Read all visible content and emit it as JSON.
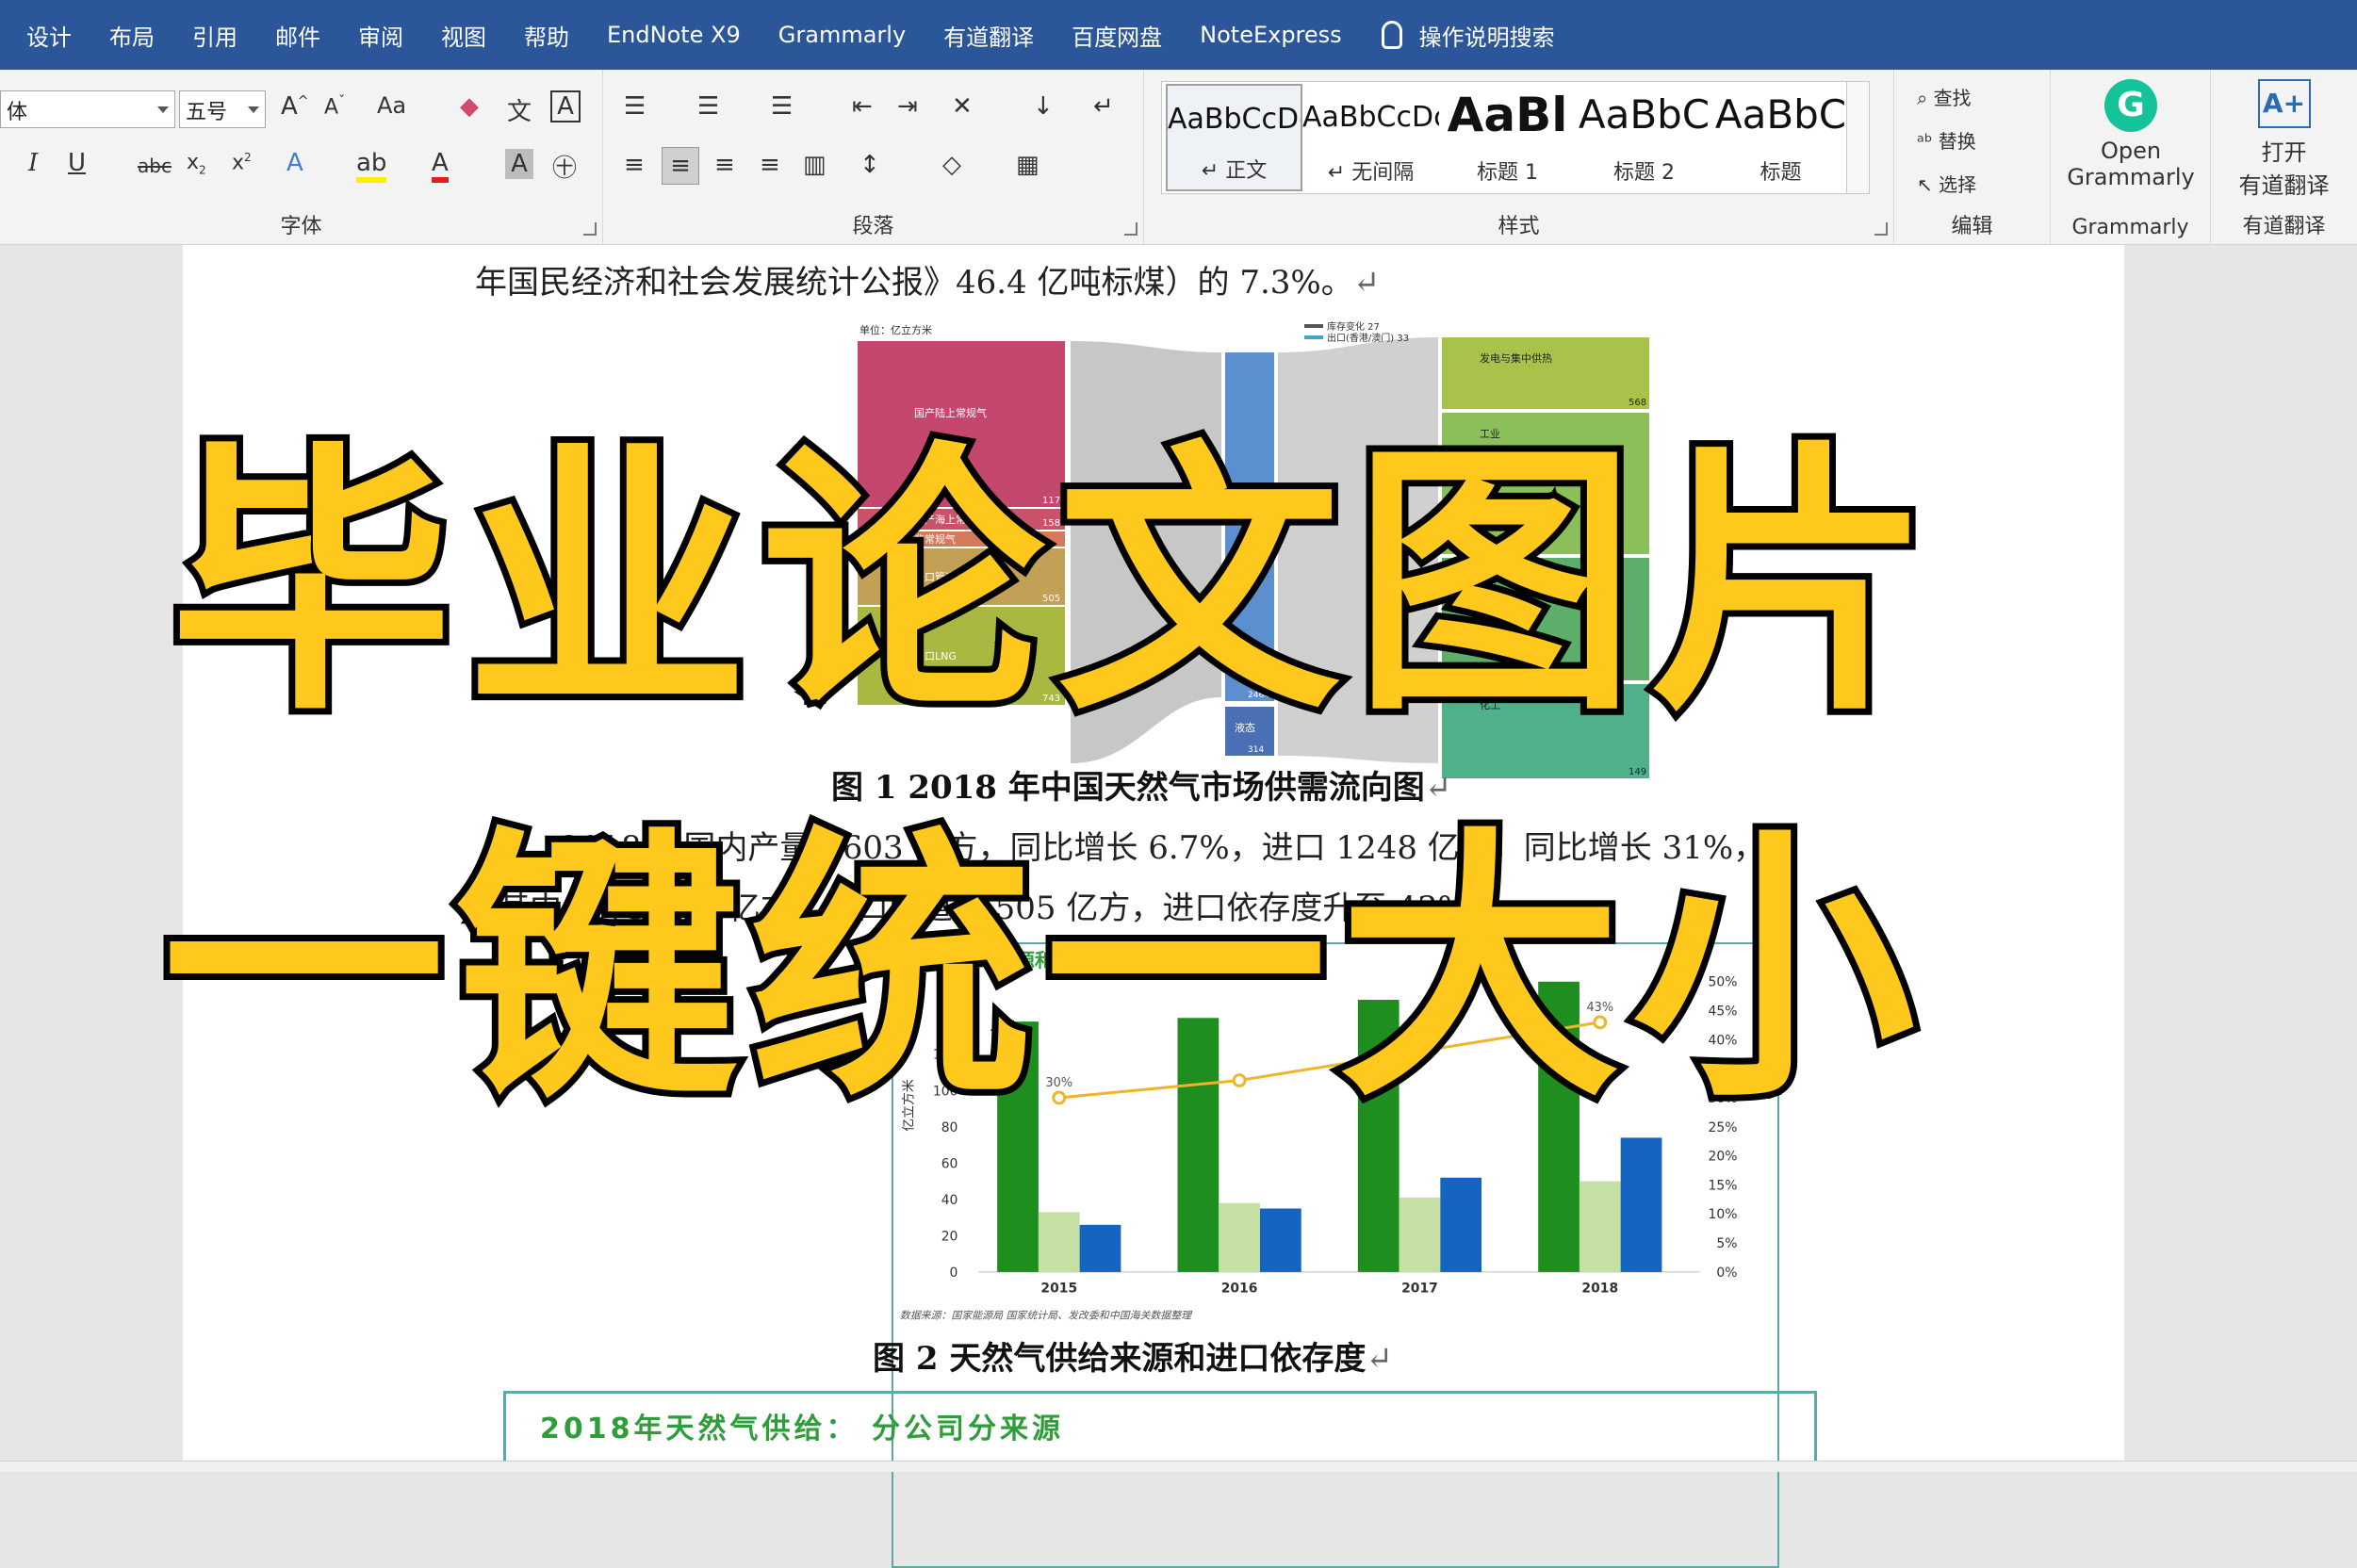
{
  "menu": {
    "items": [
      "设计",
      "布局",
      "引用",
      "邮件",
      "审阅",
      "视图",
      "帮助",
      "EndNote X9",
      "Grammarly",
      "有道翻译",
      "百度网盘",
      "NoteExpress"
    ],
    "search_label": "操作说明搜索"
  },
  "ribbon": {
    "font_group": {
      "label": "字体",
      "font_name": "体",
      "font_size": "五号",
      "buttons": [
        "A˄",
        "A˅",
        "Aa",
        "I",
        "U",
        "abc",
        "x₂",
        "x²",
        "A",
        "ab",
        "A",
        "A",
        "㊉",
        "文",
        "A"
      ]
    },
    "paragraph_group": {
      "label": "段落"
    },
    "styles_group": {
      "label": "样式",
      "tiles": [
        {
          "sample": "AaBbCcDc",
          "name": "↵ 正文"
        },
        {
          "sample": "AaBbCcDc",
          "name": "↵ 无间隔"
        },
        {
          "sample": "AaBl",
          "name": "标题 1"
        },
        {
          "sample": "AaBbC",
          "name": "标题 2"
        },
        {
          "sample": "AaBbC",
          "name": "标题"
        }
      ]
    },
    "edit_group": {
      "label": "编辑",
      "find": "查找",
      "replace": "替换",
      "select": "选择"
    },
    "grammarly_group": {
      "line1": "Open",
      "line2": "Grammarly",
      "label": "Grammarly"
    },
    "youdao_group": {
      "line1": "打开",
      "line2": "有道翻译",
      "label": "有道翻译"
    }
  },
  "document": {
    "line_top": "年国民经济和社会发展统计公报》46.4 亿吨标煤）的 7.3%。",
    "figure1_caption": "图 1  2018 年中国天然气市场供需流向图",
    "para_line1": "2018 年国内产量 1603 亿方，同比增长 6.7%，进口 1248 亿方，同比增长 31%，",
    "para_line2": "其中 LNG 743 亿方，进口管道气 505 亿方，进口依存度升至 43%。",
    "figure2_caption": "图 2  天然气供给来源和进口依存度",
    "bottom_box_title": "2018年天然气供给：  分公司分来源"
  },
  "sankey": {
    "unit_label": "单位：亿立方米",
    "left_nodes": [
      {
        "label": "国产陆上常规气",
        "value": "1177",
        "color": "#c4476e"
      },
      {
        "label": "国产海上常规气",
        "value": "158",
        "color": "#c9546a"
      },
      {
        "label": "非常规气",
        "value": "",
        "color": "#d47a5a"
      },
      {
        "label": "进口管道气",
        "value": "505",
        "color": "#c2a055"
      },
      {
        "label": "进口LNG",
        "value": "743",
        "color": "#a8b840"
      }
    ],
    "middle_nodes": [
      {
        "label": "气态",
        "value": "2464",
        "color": "#5b8fcf"
      },
      {
        "label": "液态",
        "value": "314",
        "color": "#4a6fb5"
      }
    ],
    "right_nodes": [
      {
        "label": "发电与集中供热",
        "value": "568",
        "color": "#a8c24a"
      },
      {
        "label": "工业",
        "value": "",
        "color": "#8bbf5a"
      },
      {
        "label": "城市燃气",
        "value": "",
        "color": "#5cae6a"
      },
      {
        "label": "化工",
        "value": "149",
        "color": "#4fb08a"
      }
    ],
    "legend": [
      {
        "label": "库存变化 27",
        "color": "#555555"
      },
      {
        "label": "出口(香港/澳门) 33",
        "color": "#45a3c8"
      }
    ]
  },
  "chart_data": {
    "type": "bar",
    "title": "供给来源和",
    "categories": [
      "2015",
      "2016",
      "2017",
      "2018"
    ],
    "series": [
      {
        "values": [
          138,
          140,
          150,
          160
        ],
        "color": "#1e8e1e"
      },
      {
        "values": [
          33,
          38,
          41,
          50
        ],
        "color": "#c5e0a5"
      },
      {
        "values": [
          26,
          35,
          52,
          74
        ],
        "color": "#1565c0"
      }
    ],
    "line_series": {
      "values": [
        30,
        33,
        38,
        43
      ],
      "labels": [
        "30%",
        "",
        "38%",
        "43%"
      ],
      "color": "#f0b429"
    },
    "ylabel": "亿立方米",
    "ylim": [
      0,
      160
    ],
    "y_ticks": [
      "0",
      "20",
      "40",
      "60",
      "80",
      "100",
      "120"
    ],
    "y2lim": [
      0,
      50
    ],
    "y2_ticks": [
      "0%",
      "5%",
      "10%",
      "15%",
      "20%",
      "25%",
      "30%",
      "35%",
      "40%",
      "45%",
      "50%"
    ],
    "footnote": "数据来源：国家能源局 国家统计局、发改委和中国海关数据整理"
  },
  "overlay": {
    "line1": "毕业论文图片",
    "line2": "一键统一大小"
  }
}
